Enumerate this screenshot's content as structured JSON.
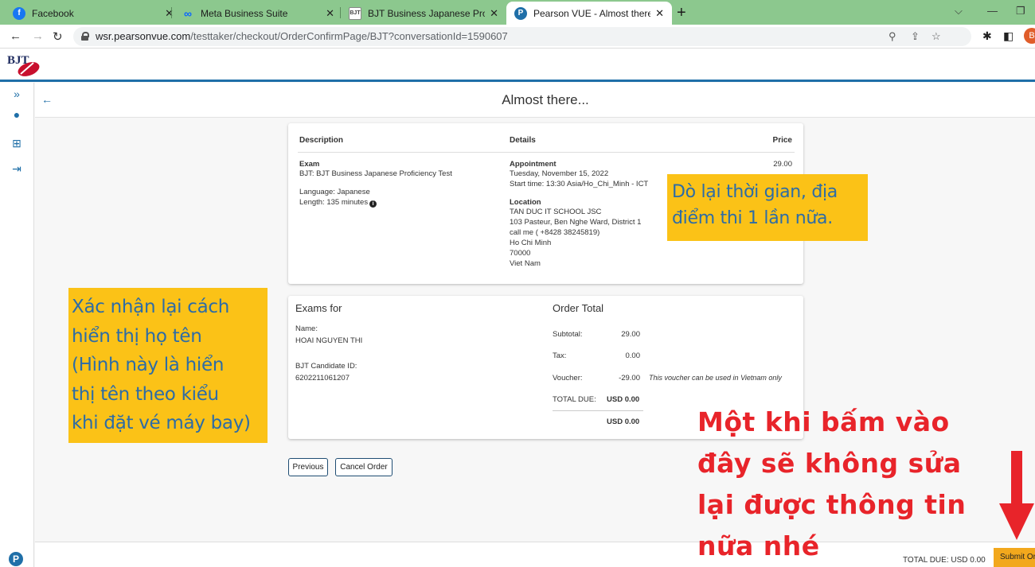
{
  "browser": {
    "tabs": [
      {
        "label": "Facebook",
        "icon": "facebook-icon",
        "color": "#1877f2"
      },
      {
        "label": "Meta Business Suite",
        "icon": "meta-icon",
        "color": "#0a66ff"
      },
      {
        "label": "BJT Business Japanese Proficienc",
        "icon": "bjt-icon",
        "color": "#555555"
      },
      {
        "label": "Pearson VUE - Almost there...",
        "icon": "pearson-icon",
        "color": "#1f6fa8"
      }
    ],
    "url_host": "wsr.pearsonvue.com",
    "url_path": "/testtaker/checkout/OrderConfirmPage/BJT?conversationId=1590607",
    "profile_initial": "B"
  },
  "page": {
    "title": "Almost there..."
  },
  "order": {
    "headers": {
      "description": "Description",
      "details": "Details",
      "price": "Price"
    },
    "exam_label": "Exam",
    "exam_name": "BJT: BJT Business Japanese Proficiency Test",
    "language": "Language: Japanese",
    "length": "Length: 135 minutes",
    "appointment_label": "Appointment",
    "appointment_date": "Tuesday, November 15, 2022",
    "start_time": "Start time: 13:30 Asia/Ho_Chi_Minh - ICT",
    "location_label": "Location",
    "location_lines": [
      "TAN DUC IT SCHOOL JSC",
      "103 Pasteur, Ben Nghe Ward, District 1",
      "call me ( +8428 38245819)",
      "Ho Chi Minh",
      "70000",
      "Viet Nam"
    ],
    "price": "29.00"
  },
  "exams_for": {
    "heading": "Exams for",
    "name_label": "Name:",
    "name": "HOAI NGUYEN THI",
    "candidate_label": "BJT Candidate ID:",
    "candidate_id": "6202211061207"
  },
  "order_total": {
    "heading": "Order Total",
    "subtotal_label": "Subtotal:",
    "subtotal": "29.00",
    "tax_label": "Tax:",
    "tax": "0.00",
    "voucher_label": "Voucher:",
    "voucher": "-29.00",
    "voucher_note": "This voucher can be used in Vietnam only",
    "total_due_label": "TOTAL DUE:",
    "total_due": "USD 0.00",
    "grand_total": "USD 0.00"
  },
  "buttons": {
    "previous": "Previous",
    "cancel": "Cancel Order",
    "submit": "Submit Order"
  },
  "footer": {
    "total_due": "TOTAL DUE: USD 0.00"
  },
  "annotations": {
    "callout_time_place": [
      "Dò lại thời gian, địa",
      "điểm thi 1 lần nữa."
    ],
    "callout_name": [
      "Xác nhận lại cách",
      "hiển thị họ tên",
      "(Hình này là hiển",
      "thị tên theo kiểu",
      "khi đặt vé máy bay)"
    ],
    "warning": [
      "Một khi bấm vào",
      "đây sẽ không sửa",
      "lại được thông tin",
      "nữa nhé"
    ]
  },
  "colors": {
    "accent": "#1f6fa8",
    "submit": "#f2a81d",
    "callout_bg": "#fbc217",
    "callout_text": "#2d6ca6",
    "warning_text": "#e8242a",
    "tabstrip": "#8cc88e"
  }
}
